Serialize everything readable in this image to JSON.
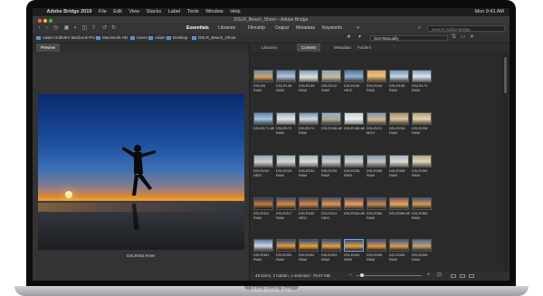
{
  "device": {
    "brand": "MacBook Pro"
  },
  "menubar": {
    "apple": "",
    "items": [
      "Adobe Bridge 2019",
      "File",
      "Edit",
      "View",
      "Stacks",
      "Label",
      "Tools",
      "Window",
      "Help"
    ],
    "clock": "Mon 9:41 AM"
  },
  "window": {
    "title": "DSLR_Beach_Shoot – Adobe Bridge"
  },
  "workspaces": [
    "Essentials",
    "Libraries",
    "Filmstrip",
    "Output",
    "Metadata",
    "Keywords"
  ],
  "active_workspace": "Essentials",
  "search": {
    "placeholder": "Search Adobe Bridge"
  },
  "path": [
    "Adam Hobble's Macbook Pro",
    "Macintosh HD",
    "Users",
    "Adam",
    "Desktop",
    "DSLR_Beach_Shoot"
  ],
  "sort": {
    "label": "Sort Manually"
  },
  "preview": {
    "tab": "Preview",
    "caption": "DSLR392.RAW"
  },
  "content_tabs": [
    "Libraries",
    "Content",
    "Metadata",
    "Folders"
  ],
  "active_content_tab": "Content",
  "thumbnails": [
    [
      "DSLR8 RAW",
      "DSLR138 RAW",
      "DSLR139 RAW",
      "DSLR142 RAW",
      "DSLR156 HEIC",
      "DSLR160 RAW",
      "DSLR165 RAW",
      "DSLR170 RAW"
    ],
    [
      "DSLR171.tiff",
      "DSLR172 RAW",
      "DSLR174 RAW",
      "DSLR186.tiff",
      "DSLR188.tiff",
      "DSLR221 MOV",
      "DSLR226 RAW",
      "DSLR228 RAW"
    ],
    [
      "DSLR232 HEIC",
      "DSLR233 RAW",
      "DSLR234 RAW",
      "DSLR235 RAW",
      "DSLR236 RAW",
      "DSLR306 RAW",
      "DSLR308 RAW",
      "DSLR309 RAW"
    ],
    [
      "DSLR312 RAW",
      "DSLR317 RAW",
      "DSLR340 HEIC",
      "DSLR341 HEIC",
      "DSLR344.tiff",
      "DSLR356 RAW",
      "DSLR358.tiff",
      "DSLR369 RAW"
    ],
    [
      "DSLR381 RAW",
      "DSLR390 RAW",
      "DSLR392 RAW",
      "DSLR393 RAW",
      "DSLR394 RAW",
      "DSLR395 RAW",
      "DSLR396 RAW",
      "DSLR398 RAW"
    ]
  ],
  "status": {
    "text": "48 items, 2 hidden, 1 selected - 79.67 MB"
  },
  "colors": {
    "accent": "#6ea8ff",
    "folder": "#5b8fd4",
    "window_bg": "#2b2b2b"
  }
}
